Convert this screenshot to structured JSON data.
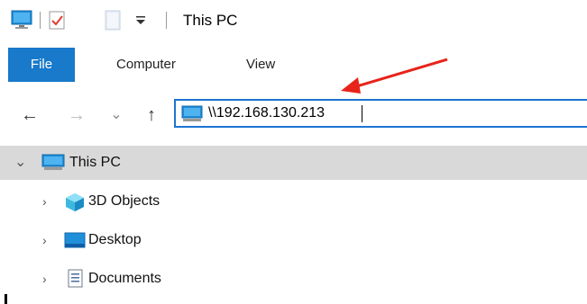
{
  "titlebar": {
    "title": "This PC",
    "icons": [
      "computer-icon",
      "properties-icon",
      "new-folder-icon",
      "customize-quick-access-icon"
    ]
  },
  "ribbon": {
    "tabs": [
      {
        "label": "File",
        "active": true
      },
      {
        "label": "Computer"
      },
      {
        "label": "View"
      }
    ],
    "accent": "#1979ca"
  },
  "nav": {
    "back": "←",
    "forward": "→",
    "recent": "⌄",
    "up": "↑"
  },
  "address": {
    "value": "\\\\192.168.130.213",
    "border_color": "#1c74d1"
  },
  "tree": {
    "items": [
      {
        "label": "This PC",
        "expanded": true,
        "selected": true,
        "icon": "computer-icon"
      },
      {
        "label": "3D Objects",
        "icon": "3d-objects-icon"
      },
      {
        "label": "Desktop",
        "icon": "desktop-icon"
      },
      {
        "label": "Documents",
        "icon": "documents-icon"
      }
    ],
    "chevron_expanded": "⌄",
    "chevron_collapsed": "›"
  },
  "annotation": {
    "arrow_color": "#e8231a"
  }
}
